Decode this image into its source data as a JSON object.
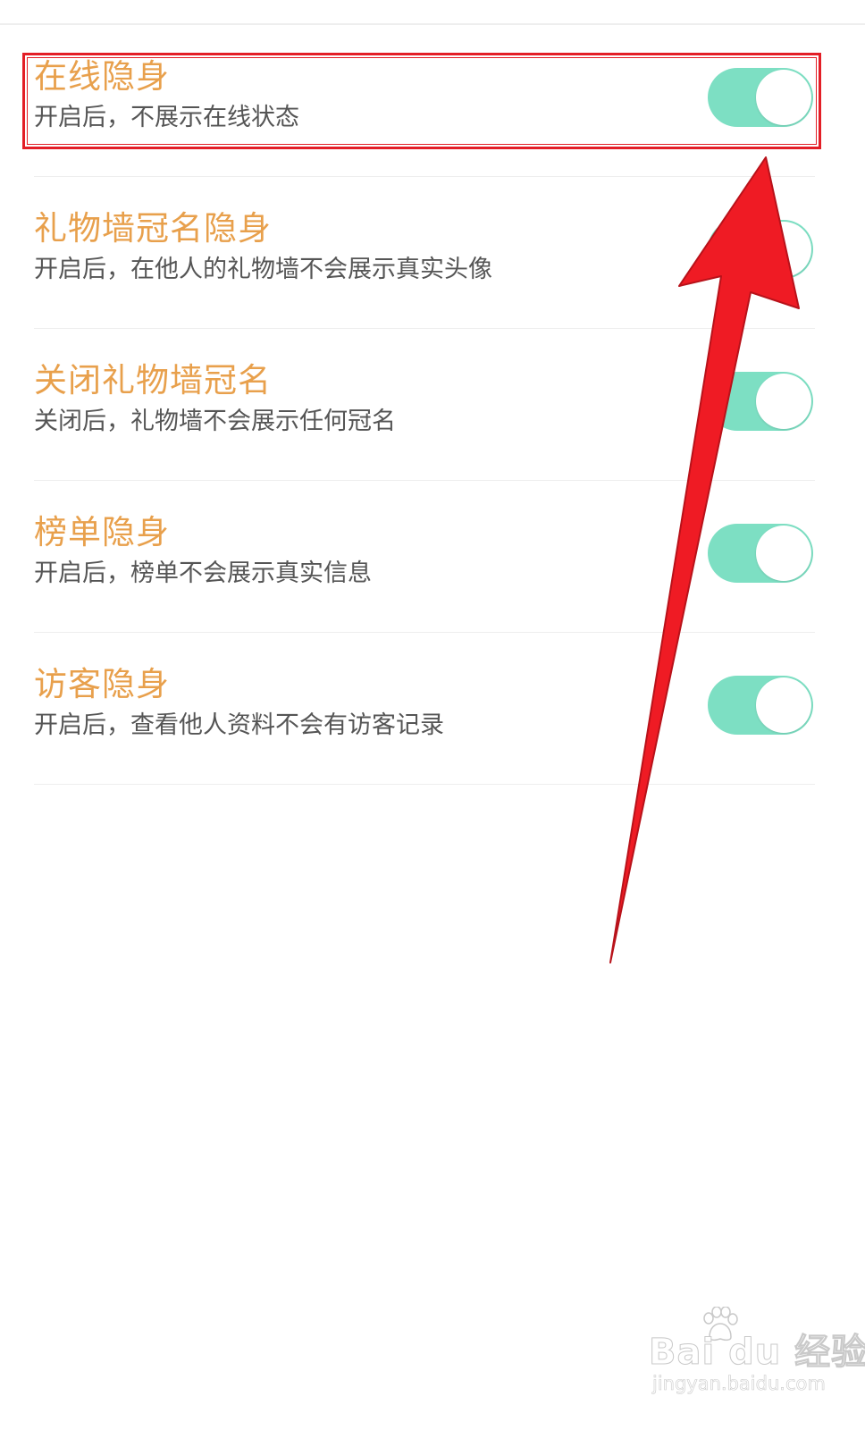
{
  "settings": [
    {
      "title": "在线隐身",
      "description": "开启后，不展示在线状态",
      "enabled": true
    },
    {
      "title": "礼物墙冠名隐身",
      "description": "开启后，在他人的礼物墙不会展示真实头像",
      "enabled": true
    },
    {
      "title": "关闭礼物墙冠名",
      "description": "关闭后，礼物墙不会展示任何冠名",
      "enabled": true
    },
    {
      "title": "榜单隐身",
      "description": "开启后，榜单不会展示真实信息",
      "enabled": true
    },
    {
      "title": "访客隐身",
      "description": "开启后，查看他人资料不会有访客记录",
      "enabled": true
    }
  ],
  "colors": {
    "title": "#e8a04c",
    "description": "#555555",
    "toggle_on": "#7ddfc3",
    "annotation": "#e31e26"
  },
  "watermark": {
    "logo": "Bai du 经验",
    "url": "jingyan.baidu.com"
  }
}
